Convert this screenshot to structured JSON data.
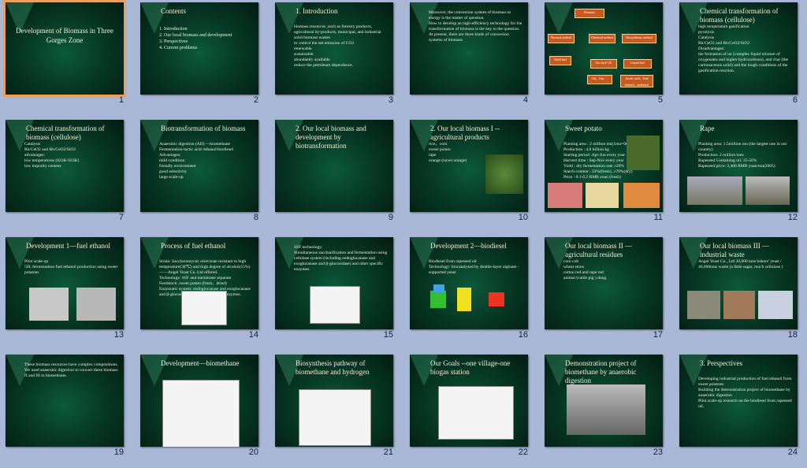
{
  "slides": [
    {
      "num": "1",
      "title": "Development  of Biomass in Three Gorges Zone",
      "lines": []
    },
    {
      "num": "2",
      "title": "Contents",
      "lines": [
        "1.   Introduction",
        "2.   Our local biomass and development",
        "3.   Perspectives",
        "4.   Current problems"
      ]
    },
    {
      "num": "3",
      "title": "1. Introduction",
      "lines": [
        "biomass resources ,such as forestry products, agricultural by-products, municipal, and industrial solid biomass wastes",
        "to control the net emission of CO2",
        "renewable",
        "sustainable",
        "abundantly available",
        "reduce the petroleum dependence."
      ]
    },
    {
      "num": "4",
      "title": "",
      "lines": [
        "Moreover, the conversion system of biomass to energy is the matter of question.",
        "How to develop an high-efficiency technology for the transformation of biomass is the key to the question.",
        "At present, there are three kinds of conversion systems of biomass"
      ]
    },
    {
      "num": "5",
      "title": "",
      "lines": [
        "Biomass",
        "Physical method",
        "Chemical method",
        "Biosynthesis method",
        "Solid fuel",
        "Gas  fuel/ Oil",
        "Liquid fuel",
        "Oil，Gas  …",
        "Acetic acid，Fuel ethanol，methanol"
      ]
    },
    {
      "num": "6",
      "title": "Chemical transformation of biomass (cellulose)",
      "lines": [
        "high temperature gasification",
        "pyrolysis",
        "Catalysis",
        "Rh/CeO2 and Rh/CeO2/SiO2",
        "Disadvantages:",
        "the formation of tar (complex liquid mixture of oxygenates and higher hydrocarbons), and char (the carbonaceous solid) and the tough conditions of the gasification reaction."
      ]
    },
    {
      "num": "7",
      "title": "Chemical transformation of biomass (cellulose)",
      "lines": [
        "Catalysis",
        "Rh/CeO2 and Rh/CeO2/SiO2",
        "advantages:",
        "low temperatures (823K-923K)",
        "low impurity content"
      ]
    },
    {
      "num": "8",
      "title": "Biotransformation of biomass",
      "lines": [
        "Anaerobic digestion (AD)  —biomethane",
        "Fermentation-lactic acid /ethanol/biodiesel",
        "Advantages:",
        "mild condition",
        "friendly environment",
        "good selectivity",
        "large scale-up"
      ]
    },
    {
      "num": "9",
      "title": "2.   Our local biomass and development by biotransformation",
      "lines": []
    },
    {
      "num": "10",
      "title": "2. Our local biomass I -- agricultural products",
      "lines": [
        "rice、corn",
        "sweet potato",
        "rape",
        "orange (navel orange)"
      ]
    },
    {
      "num": "11",
      "title": "Sweet potato",
      "lines": [
        "Planting area :  2 million mu(1mu=666.7m²)",
        "Production : 4.8 billion kg",
        "Starting period :Apr-Jun every year",
        "Harvest time : Sep-Nov every year",
        "Yield : dry fermentation rate  ≥28%",
        "Starch content : 33%(fresh), ≥70%(dry)",
        "Price : 0.1-0.2 RMB yuan (fresh)"
      ]
    },
    {
      "num": "12",
      "title": "Rape",
      "lines": [
        "Planting area: 1.5million mu (the largest one in our country)",
        "Production: 2 million tons",
        "Rapeseed Containing oil: 35-50%",
        "Rapeseed price: 2,400 RMB yuan/ton(2005)"
      ]
    },
    {
      "num": "13",
      "title": "Development 1—fuel ethanol",
      "lines": [
        "Pilot scale-up",
        "50L fermentation fuel ethanol production using sweet potatoes"
      ]
    },
    {
      "num": "14",
      "title": "Process of fuel ethanol",
      "lines": [
        "Strain: Saccharomyces cerevisiae  resistant to high temperature(38℃) and high degree of alcohol(15%)——Angel Yeast Co. Ltd offered.",
        "Technology: SSF and membrane separate",
        "Feedstock: sweet potato (fresh、dried)",
        "Enzymatic system: endoglucanase and exoglucanase and β-glucosidase) and other specific enzymes."
      ]
    },
    {
      "num": "15",
      "title": "",
      "lines": [
        "SSF technology:",
        "Simultaneous saccharification and fermentation using cellulase system (including endoglucanase and exoglucanase and β-glucosidase) and other specific enzymes."
      ]
    },
    {
      "num": "16",
      "title": "Development 2—biodiesel",
      "lines": [
        "Biodiesel from rapeseed oil",
        "Technology: biocatalyzed by double-layer alginate -supported yeast"
      ]
    },
    {
      "num": "17",
      "title": "Our local biomass II —agricultural residues",
      "lines": [
        "corn cob",
        "wheat straw",
        "cotton red  and rape red",
        "animal (cattle pig ) dung"
      ]
    },
    {
      "num": "18",
      "title": "Our local biomass  III —industrial waste",
      "lines": [
        "Angel Yeast Co., Ltd  20,000 tons bakers' yeast / 40,000tons waste (a little sugar, much cellulose )"
      ]
    },
    {
      "num": "19",
      "title": "",
      "lines": [
        "These biomass resources have complex compositions.",
        "We used anaerobic digestion to convert these biomass II and III to biomethane."
      ]
    },
    {
      "num": "20",
      "title": "Development—biomethane",
      "lines": []
    },
    {
      "num": "21",
      "title": "Biosynthesis pathway of biomethane and hydrogen",
      "lines": []
    },
    {
      "num": "22",
      "title": "Our Goals --one village-one biogas station",
      "lines": []
    },
    {
      "num": "23",
      "title": "Demonstration project of biomethane by anaerobic digestion",
      "lines": []
    },
    {
      "num": "24",
      "title": "3. Perspectives",
      "lines": [
        "Developing industrial production of fuel ethanol from sweet potatoes",
        "Building the demonstration project of biomethane by anaerobic digestion",
        "Pilot scale-up research on the biodiesel from rapeseed oil."
      ]
    }
  ]
}
